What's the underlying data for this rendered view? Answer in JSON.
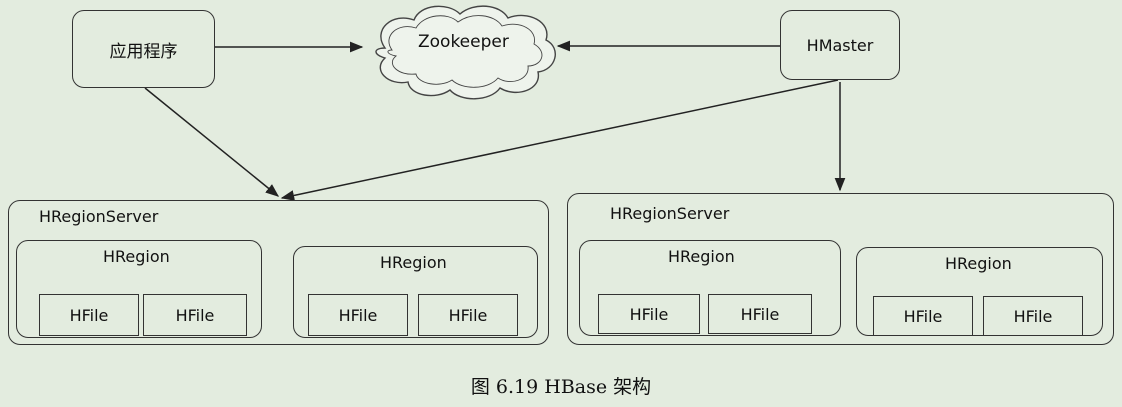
{
  "nodes": {
    "app": "应用程序",
    "zookeeper": "Zookeeper",
    "hmaster": "HMaster"
  },
  "servers": [
    {
      "label": "HRegionServer",
      "regions": [
        {
          "label": "HRegion",
          "files": [
            "HFile",
            "HFile"
          ]
        },
        {
          "label": "HRegion",
          "files": [
            "HFile",
            "HFile"
          ]
        }
      ]
    },
    {
      "label": "HRegionServer",
      "regions": [
        {
          "label": "HRegion",
          "files": [
            "HFile",
            "HFile"
          ]
        },
        {
          "label": "HRegion",
          "files": [
            "HFile",
            "HFile"
          ]
        }
      ]
    }
  ],
  "caption": "图 6.19 HBase 架构",
  "colors": {
    "background": "#e3ecdf",
    "stroke": "#333333"
  }
}
